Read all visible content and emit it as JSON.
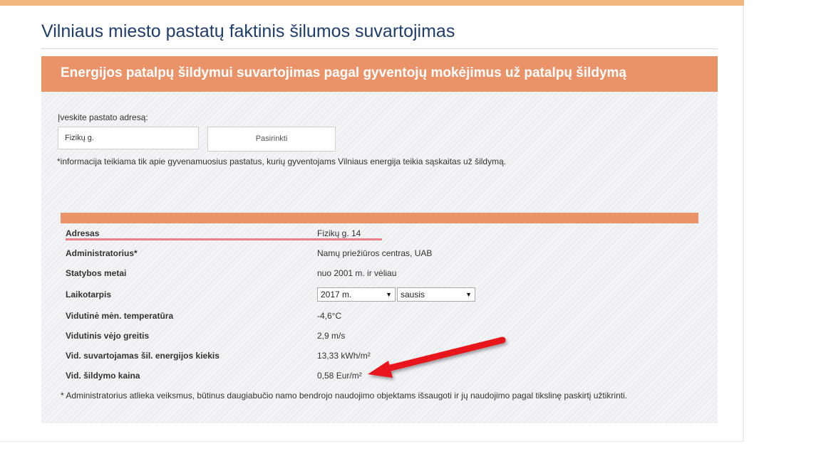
{
  "page": {
    "title": "Vilniaus miesto pastatų faktinis šilumos suvartojimas"
  },
  "section": {
    "heading": "Energijos patalpų šildymui suvartojimas pagal gyventojų mokėjimus už patalpų šildymą"
  },
  "search": {
    "label": "Įveskite pastato adresą:",
    "value": "Fizikų g.",
    "button_label": "Pasirinkti",
    "note": "*informacija teikiama tik apie gyvenamuosius pastatus, kurių gyventojams Vilniaus energija teikia sąskaitas už šildymą."
  },
  "details": {
    "address": {
      "label": "Adresas",
      "value": "Fizikų g. 14"
    },
    "administrator": {
      "label": "Administratorius*",
      "value": "Namų priežiūros centras, UAB"
    },
    "build_year": {
      "label": "Statybos metai",
      "value": "nuo 2001 m. ir vėliau"
    },
    "period": {
      "label": "Laikotarpis",
      "year": "2017 m.",
      "month": "sausis"
    },
    "temperature": {
      "label": "Vidutinė mėn. temperatūra",
      "value": "-4,6°C"
    },
    "wind": {
      "label": "Vidutinis vėjo greitis",
      "value": "2,9 m/s"
    },
    "energy": {
      "label": "Vid. suvartojamas šil. energijos kiekis",
      "value": "13,33 kWh/m²"
    },
    "price": {
      "label": "Vid. šildymo kaina",
      "value": "0,58 Eur/m²"
    }
  },
  "footnote": "* Administratorius atlieka veiksmus, būtinus daugiabučio namo bendrojo naudojimo objektams išsaugoti ir jų naudojimo pagal tikslinę paskirtį užtikrinti.",
  "colors": {
    "accent": "#ea9369",
    "title": "#1f3d6b",
    "top_bar": "#f0b87e",
    "arrow": "#e8141b",
    "underline": "#f07f86"
  },
  "icons": {
    "dropdown": "dropdown-arrow-icon",
    "annotation": "red-arrow-annotation"
  }
}
